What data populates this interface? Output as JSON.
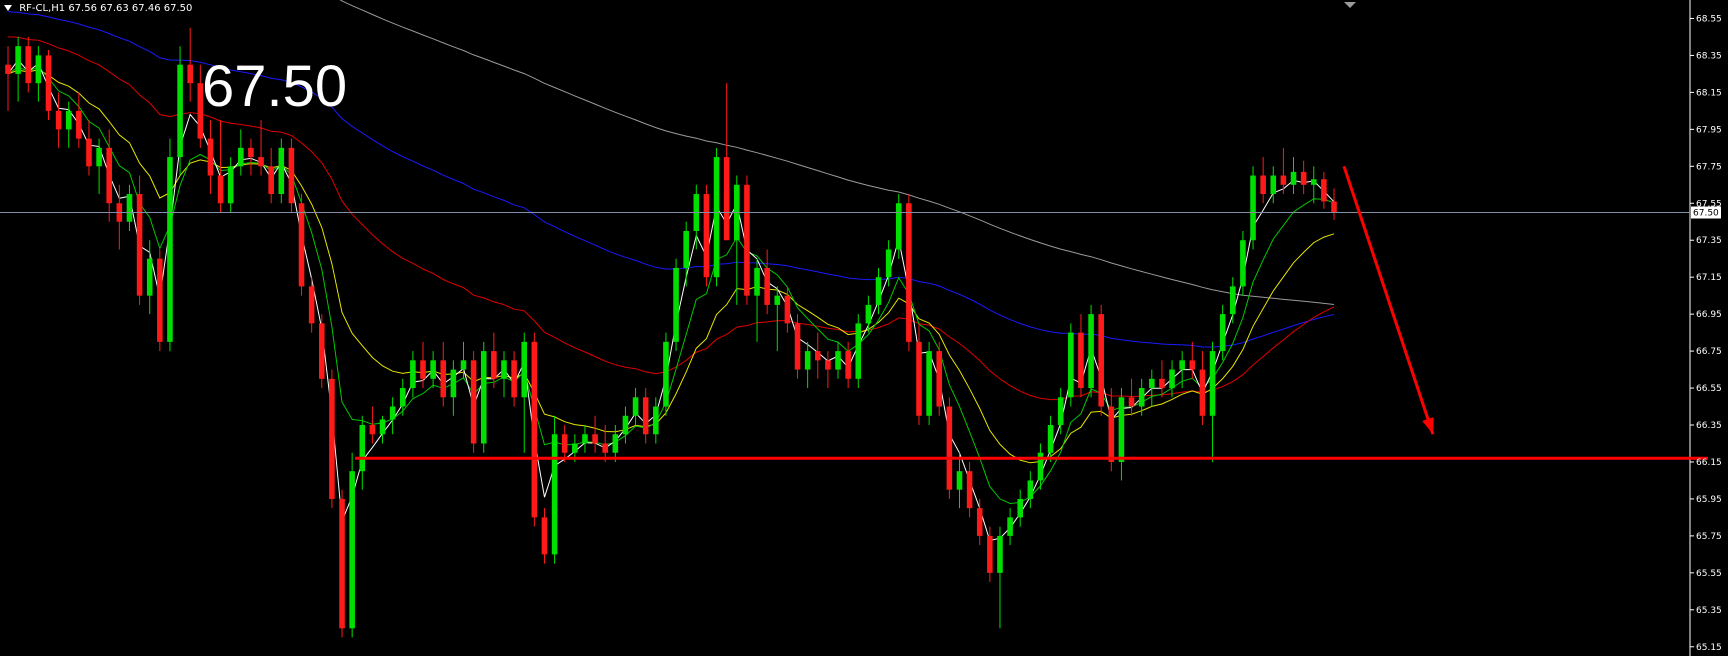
{
  "header": {
    "symbol": "RF-CL,H1",
    "ohlc": "67.56 67.63 67.46 67.50"
  },
  "big_price": "67.50",
  "colors": {
    "background": "#000000",
    "bull": "#00e000",
    "bear": "#ff1a1a",
    "ma_white": "#ffffff",
    "ma_green": "#00c800",
    "ma_yellow": "#e6e600",
    "ma_red": "#e00000",
    "ma_blue": "#1a1aff",
    "ma_gray": "#9a9a9a",
    "support": "#ff0000",
    "arrow": "#ff0000",
    "current_price_line": "#7f8fa6",
    "axis": "#ffffff"
  },
  "chart_data": {
    "type": "candlestick",
    "timeframe": "H1",
    "ylim": [
      65.1,
      68.65
    ],
    "yticks": [
      "68.55",
      "68.35",
      "68.15",
      "67.95",
      "67.75",
      "67.55",
      "67.35",
      "67.15",
      "66.95",
      "66.75",
      "66.55",
      "66.35",
      "66.15",
      "65.95",
      "65.75",
      "65.55",
      "65.35",
      "65.15"
    ],
    "current_price": 67.5,
    "current_price_label": "67.50",
    "support_level": 66.17,
    "candles": [
      [
        68.3,
        68.4,
        68.05,
        68.25
      ],
      [
        68.25,
        68.45,
        68.1,
        68.4
      ],
      [
        68.4,
        68.45,
        68.15,
        68.2
      ],
      [
        68.2,
        68.4,
        68.1,
        68.35
      ],
      [
        68.35,
        68.38,
        68.0,
        68.05
      ],
      [
        68.05,
        68.15,
        67.85,
        67.95
      ],
      [
        67.95,
        68.1,
        67.85,
        68.05
      ],
      [
        68.05,
        68.15,
        67.85,
        67.9
      ],
      [
        67.9,
        68.0,
        67.7,
        67.75
      ],
      [
        67.75,
        67.9,
        67.6,
        67.85
      ],
      [
        67.85,
        67.95,
        67.45,
        67.55
      ],
      [
        67.55,
        67.65,
        67.3,
        67.45
      ],
      [
        67.45,
        67.65,
        67.4,
        67.6
      ],
      [
        67.6,
        67.7,
        67.0,
        67.05
      ],
      [
        67.05,
        67.35,
        66.95,
        67.25
      ],
      [
        67.25,
        67.3,
        66.75,
        66.8
      ],
      [
        66.8,
        67.9,
        66.75,
        67.8
      ],
      [
        67.8,
        68.4,
        67.7,
        68.3
      ],
      [
        68.3,
        68.5,
        68.1,
        68.2
      ],
      [
        68.2,
        68.3,
        67.85,
        67.9
      ],
      [
        67.9,
        68.0,
        67.6,
        67.7
      ],
      [
        67.7,
        68.0,
        67.5,
        67.55
      ],
      [
        67.55,
        67.8,
        67.5,
        67.75
      ],
      [
        67.75,
        67.95,
        67.7,
        67.85
      ],
      [
        67.85,
        67.9,
        67.7,
        67.8
      ],
      [
        67.8,
        68.0,
        67.7,
        67.75
      ],
      [
        67.75,
        67.85,
        67.55,
        67.6
      ],
      [
        67.6,
        67.9,
        67.55,
        67.85
      ],
      [
        67.85,
        67.9,
        67.5,
        67.55
      ],
      [
        67.55,
        67.6,
        67.05,
        67.1
      ],
      [
        67.1,
        67.15,
        66.85,
        66.9
      ],
      [
        66.9,
        66.95,
        66.55,
        66.6
      ],
      [
        66.6,
        66.65,
        65.9,
        65.95
      ],
      [
        65.95,
        66.0,
        65.2,
        65.25
      ],
      [
        65.25,
        66.2,
        65.2,
        66.1
      ],
      [
        66.1,
        66.4,
        66.0,
        66.35
      ],
      [
        66.35,
        66.45,
        66.25,
        66.3
      ],
      [
        66.3,
        66.4,
        66.25,
        66.38
      ],
      [
        66.38,
        66.5,
        66.3,
        66.45
      ],
      [
        66.45,
        66.6,
        66.4,
        66.55
      ],
      [
        66.55,
        66.75,
        66.5,
        66.7
      ],
      [
        66.7,
        66.8,
        66.55,
        66.6
      ],
      [
        66.6,
        66.75,
        66.55,
        66.7
      ],
      [
        66.7,
        66.8,
        66.45,
        66.5
      ],
      [
        66.5,
        66.7,
        66.4,
        66.65
      ],
      [
        66.65,
        66.8,
        66.6,
        66.7
      ],
      [
        66.7,
        66.75,
        66.2,
        66.25
      ],
      [
        66.25,
        66.8,
        66.2,
        66.75
      ],
      [
        66.75,
        66.85,
        66.55,
        66.6
      ],
      [
        66.6,
        66.75,
        66.5,
        66.7
      ],
      [
        66.7,
        66.75,
        66.45,
        66.5
      ],
      [
        66.5,
        66.85,
        66.2,
        66.8
      ],
      [
        66.8,
        66.85,
        65.8,
        65.85
      ],
      [
        65.85,
        65.9,
        65.6,
        65.65
      ],
      [
        65.65,
        66.4,
        65.6,
        66.3
      ],
      [
        66.3,
        66.35,
        66.15,
        66.2
      ],
      [
        66.2,
        66.3,
        66.15,
        66.25
      ],
      [
        66.25,
        66.35,
        66.2,
        66.3
      ],
      [
        66.3,
        66.4,
        66.2,
        66.25
      ],
      [
        66.25,
        66.35,
        66.15,
        66.2
      ],
      [
        66.2,
        66.35,
        66.15,
        66.3
      ],
      [
        66.3,
        66.45,
        66.25,
        66.4
      ],
      [
        66.4,
        66.55,
        66.35,
        66.5
      ],
      [
        66.5,
        66.55,
        66.25,
        66.3
      ],
      [
        66.3,
        66.5,
        66.25,
        66.45
      ],
      [
        66.45,
        66.85,
        66.4,
        66.8
      ],
      [
        66.8,
        67.25,
        66.75,
        67.2
      ],
      [
        67.2,
        67.45,
        67.1,
        67.4
      ],
      [
        67.4,
        67.65,
        67.3,
        67.6
      ],
      [
        67.6,
        67.65,
        67.1,
        67.15
      ],
      [
        67.15,
        67.85,
        67.1,
        67.8
      ],
      [
        67.8,
        68.2,
        67.7,
        67.35
      ],
      [
        67.35,
        67.7,
        67.0,
        67.65
      ],
      [
        67.65,
        67.7,
        67.0,
        67.05
      ],
      [
        67.05,
        67.25,
        66.8,
        67.2
      ],
      [
        67.2,
        67.3,
        66.95,
        67.0
      ],
      [
        67.0,
        67.1,
        66.75,
        67.05
      ],
      [
        67.05,
        67.1,
        66.85,
        66.9
      ],
      [
        66.9,
        66.95,
        66.6,
        66.65
      ],
      [
        66.65,
        66.8,
        66.55,
        66.75
      ],
      [
        66.75,
        66.85,
        66.6,
        66.7
      ],
      [
        66.7,
        66.75,
        66.55,
        66.65
      ],
      [
        66.65,
        66.8,
        66.6,
        66.75
      ],
      [
        66.75,
        66.8,
        66.55,
        66.6
      ],
      [
        66.6,
        66.95,
        66.55,
        66.9
      ],
      [
        66.9,
        67.05,
        66.85,
        67.0
      ],
      [
        67.0,
        67.2,
        66.95,
        67.15
      ],
      [
        67.15,
        67.35,
        67.1,
        67.3
      ],
      [
        67.3,
        67.6,
        67.25,
        67.55
      ],
      [
        67.55,
        67.6,
        66.75,
        66.8
      ],
      [
        66.8,
        66.9,
        66.35,
        66.4
      ],
      [
        66.4,
        66.8,
        66.35,
        66.75
      ],
      [
        66.75,
        66.8,
        66.4,
        66.45
      ],
      [
        66.45,
        66.5,
        65.95,
        66.0
      ],
      [
        66.0,
        66.2,
        65.9,
        66.1
      ],
      [
        66.1,
        66.15,
        65.85,
        65.9
      ],
      [
        65.9,
        65.95,
        65.7,
        65.75
      ],
      [
        65.75,
        65.8,
        65.5,
        65.55
      ],
      [
        65.55,
        65.8,
        65.25,
        65.75
      ],
      [
        65.75,
        65.9,
        65.7,
        65.85
      ],
      [
        65.85,
        66.0,
        65.8,
        65.95
      ],
      [
        65.95,
        66.1,
        65.9,
        66.05
      ],
      [
        66.05,
        66.25,
        66.0,
        66.2
      ],
      [
        66.2,
        66.4,
        66.15,
        66.35
      ],
      [
        66.35,
        66.55,
        66.3,
        66.5
      ],
      [
        66.5,
        66.9,
        66.45,
        66.85
      ],
      [
        66.85,
        66.95,
        66.5,
        66.55
      ],
      [
        66.55,
        67.0,
        66.5,
        66.95
      ],
      [
        66.95,
        67.0,
        66.4,
        66.45
      ],
      [
        66.45,
        66.55,
        66.1,
        66.15
      ],
      [
        66.15,
        66.55,
        66.05,
        66.5
      ],
      [
        66.5,
        66.6,
        66.4,
        66.45
      ],
      [
        66.45,
        66.6,
        66.4,
        66.55
      ],
      [
        66.55,
        66.65,
        66.45,
        66.6
      ],
      [
        66.6,
        66.7,
        66.5,
        66.55
      ],
      [
        66.55,
        66.7,
        66.5,
        66.65
      ],
      [
        66.65,
        66.75,
        66.55,
        66.7
      ],
      [
        66.7,
        66.8,
        66.6,
        66.65
      ],
      [
        66.65,
        66.75,
        66.35,
        66.4
      ],
      [
        66.4,
        66.8,
        66.15,
        66.75
      ],
      [
        66.75,
        67.0,
        66.7,
        66.95
      ],
      [
        66.95,
        67.15,
        66.9,
        67.1
      ],
      [
        67.1,
        67.4,
        67.05,
        67.35
      ],
      [
        67.35,
        67.75,
        67.3,
        67.7
      ],
      [
        67.7,
        67.8,
        67.55,
        67.6
      ],
      [
        67.6,
        67.75,
        67.55,
        67.7
      ],
      [
        67.7,
        67.85,
        67.6,
        67.65
      ],
      [
        67.65,
        67.8,
        67.6,
        67.72
      ],
      [
        67.72,
        67.78,
        67.6,
        67.65
      ],
      [
        67.65,
        67.75,
        67.55,
        67.68
      ],
      [
        67.68,
        67.72,
        67.52,
        67.56
      ],
      [
        67.56,
        67.63,
        67.46,
        67.5
      ]
    ]
  }
}
